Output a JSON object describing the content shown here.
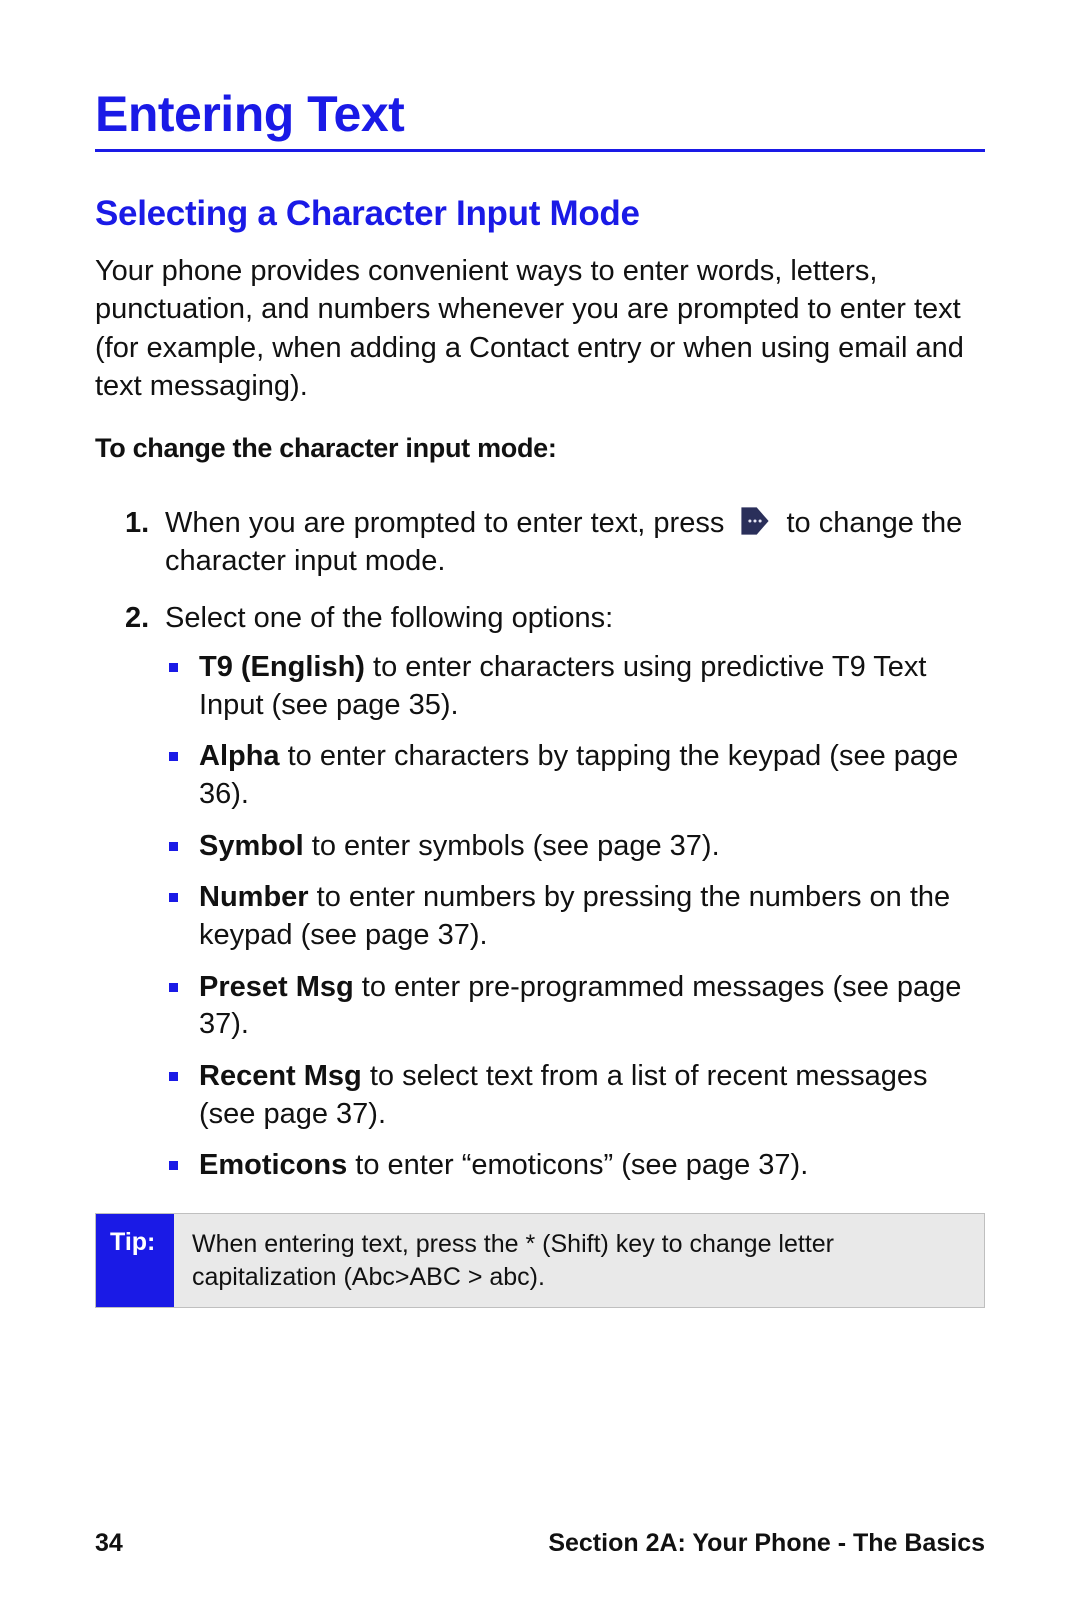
{
  "heading": "Entering Text",
  "subheading": "Selecting a Character Input Mode",
  "intro": "Your phone provides convenient ways to enter words, letters, punctuation, and numbers whenever you are prompted to enter text (for example, when adding a Contact entry or when using email and text messaging).",
  "procedure_label": "To change the character input mode:",
  "step1": {
    "num": "1.",
    "pre": "When you are prompted to enter text, press ",
    "post": " to change the character input mode."
  },
  "step2": {
    "num": "2.",
    "text": "Select one of the following options:"
  },
  "options": [
    {
      "bold": "T9 (English)",
      "rest": " to enter characters using predictive T9 Text Input (see page 35)."
    },
    {
      "bold": "Alpha",
      "rest": " to enter characters by tapping the keypad (see page 36)."
    },
    {
      "bold": "Symbol",
      "rest": " to enter symbols (see page 37)."
    },
    {
      "bold": "Number",
      "rest": " to enter numbers by pressing the numbers on the keypad (see page 37)."
    },
    {
      "bold": "Preset Msg",
      "rest": " to enter pre-programmed messages (see page 37)."
    },
    {
      "bold": "Recent Msg",
      "rest": " to select text from a list of recent messages (see page 37)."
    },
    {
      "bold": "Emoticons",
      "rest": " to enter “emoticons” (see page 37)."
    }
  ],
  "tip": {
    "label": "Tip:",
    "text": "When entering text, press the * (Shift) key to change letter capitalization (Abc>ABC > abc)."
  },
  "footer": {
    "page": "34",
    "section": "Section 2A: Your Phone - The Basics"
  }
}
